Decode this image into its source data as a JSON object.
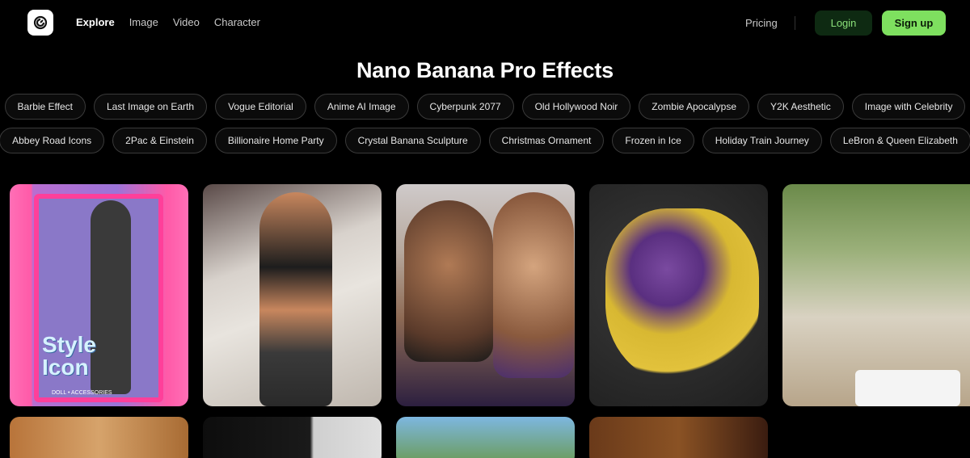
{
  "header": {
    "nav": [
      {
        "label": "Explore",
        "active": true
      },
      {
        "label": "Image",
        "active": false
      },
      {
        "label": "Video",
        "active": false
      },
      {
        "label": "Character",
        "active": false
      }
    ],
    "pricing_label": "Pricing",
    "login_label": "Login",
    "signup_label": "Sign up"
  },
  "page": {
    "title": "Nano Banana Pro Effects"
  },
  "effects": {
    "row1": [
      "Barbie Effect",
      "Last Image on Earth",
      "Vogue Editorial",
      "Anime AI Image",
      "Cyberpunk 2077",
      "Old Hollywood Noir",
      "Zombie Apocalypse",
      "Y2K Aesthetic",
      "Image with Celebrity"
    ],
    "row2": [
      "Abbey Road Icons",
      "2Pac & Einstein",
      "Billionaire Home Party",
      "Crystal Banana Sculpture",
      "Christmas Ornament",
      "Frozen in Ice",
      "Holiday Train Journey",
      "LeBron & Queen Elizabeth"
    ]
  },
  "gallery": {
    "card1_text": "Style Icon",
    "card1_subtext": "DOLL • ACCESSORIES"
  },
  "colors": {
    "accent": "#7ee05f",
    "login_bg": "#0e2a12",
    "login_text": "#8be07a",
    "background": "#000000"
  },
  "icons": {
    "logo": "app-logo-icon"
  }
}
